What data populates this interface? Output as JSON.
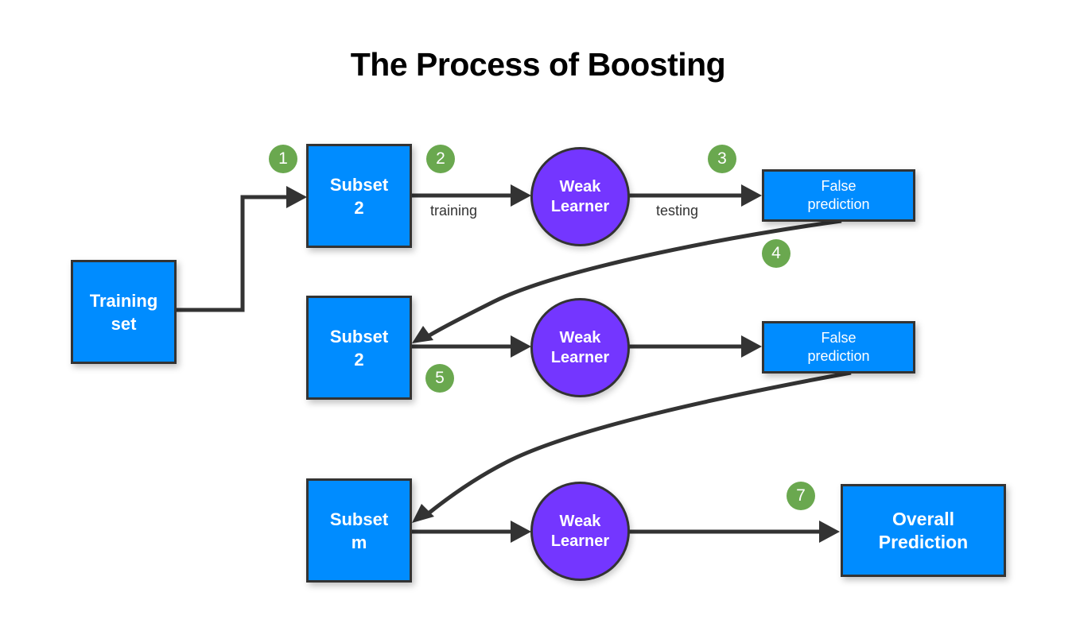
{
  "title": "The Process of Boosting",
  "nodes": {
    "training_set": {
      "line1": "Training",
      "line2": "set"
    },
    "subset_row1": {
      "line1": "Subset",
      "line2": "2"
    },
    "subset_row2": {
      "line1": "Subset",
      "line2": "2"
    },
    "subset_row3": {
      "line1": "Subset",
      "line2": "m"
    },
    "weak_learner_row1": {
      "line1": "Weak",
      "line2": "Learner"
    },
    "weak_learner_row2": {
      "line1": "Weak",
      "line2": "Learner"
    },
    "weak_learner_row3": {
      "line1": "Weak",
      "line2": "Learner"
    },
    "false_prediction_row1": {
      "line1": "False",
      "line2": "prediction"
    },
    "false_prediction_row2": {
      "line1": "False",
      "line2": "prediction"
    },
    "overall_prediction": {
      "line1": "Overall",
      "line2": "Prediction"
    }
  },
  "edge_labels": {
    "training": "training",
    "testing": "testing"
  },
  "steps": [
    "1",
    "2",
    "3",
    "4",
    "5",
    "7"
  ],
  "colors": {
    "box_fill": "#008cff",
    "circle_fill": "#7436ff",
    "badge_fill": "#6aa84f",
    "stroke": "#333333"
  }
}
